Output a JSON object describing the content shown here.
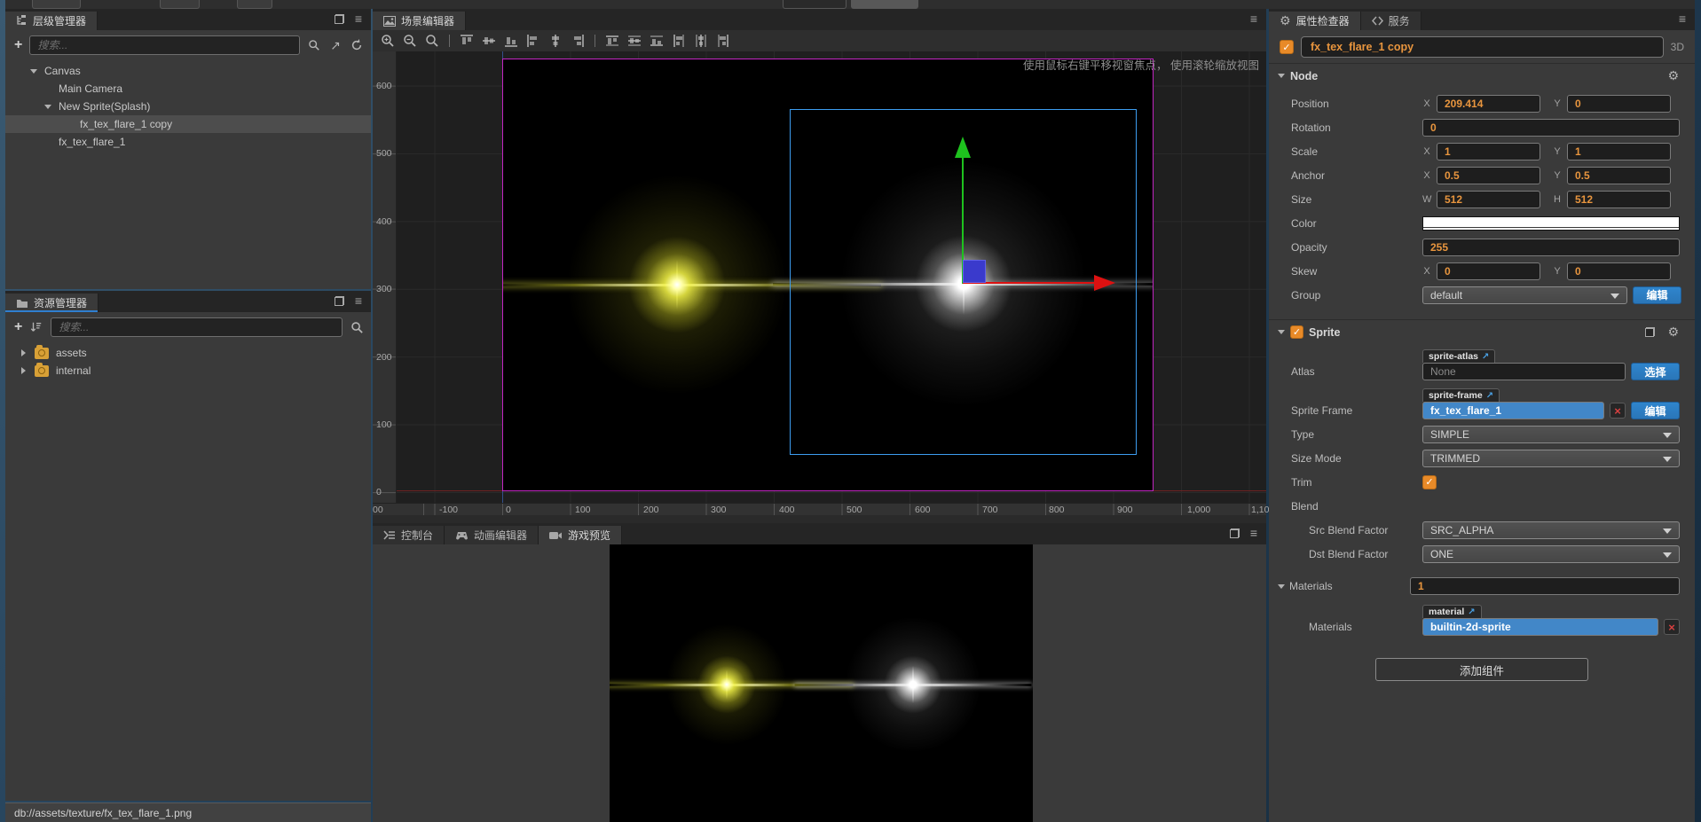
{
  "hierarchy": {
    "tab_label": "层级管理器",
    "search_placeholder": "搜索...",
    "tree": [
      {
        "label": "Canvas"
      },
      {
        "label": "Main Camera"
      },
      {
        "label": "New Sprite(Splash)"
      },
      {
        "label": "fx_tex_flare_1 copy"
      },
      {
        "label": "fx_tex_flare_1"
      }
    ]
  },
  "assets": {
    "tab_label": "资源管理器",
    "search_placeholder": "搜索...",
    "tree": [
      {
        "label": "assets"
      },
      {
        "label": "internal"
      }
    ],
    "status_bar": "db://assets/texture/fx_tex_flare_1.png"
  },
  "scene": {
    "tab_label": "场景编辑器",
    "hint": "使用鼠标右键平移视窗焦点， 使用滚轮缩放视图",
    "ruler_y": [
      "600",
      "500",
      "400",
      "300",
      "200",
      "100",
      "0"
    ],
    "ruler_x": [
      "00",
      "-100",
      "0",
      "100",
      "200",
      "300",
      "400",
      "500",
      "600",
      "700",
      "800",
      "900",
      "1,000",
      "1,10"
    ]
  },
  "bottom_panel": {
    "tabs": [
      {
        "label": "控制台"
      },
      {
        "label": "动画编辑器"
      },
      {
        "label": "游戏预览"
      }
    ]
  },
  "inspector": {
    "tab_inspector": "属性检查器",
    "tab_services": "服务",
    "node_name": "fx_tex_flare_1 copy",
    "mode_label": "3D",
    "node": {
      "title": "Node",
      "position": {
        "label": "Position",
        "x_label": "X",
        "x": "209.414",
        "y_label": "Y",
        "y": "0"
      },
      "rotation": {
        "label": "Rotation",
        "value": "0"
      },
      "scale": {
        "label": "Scale",
        "x_label": "X",
        "x": "1",
        "y_label": "Y",
        "y": "1"
      },
      "anchor": {
        "label": "Anchor",
        "x_label": "X",
        "x": "0.5",
        "y_label": "Y",
        "y": "0.5"
      },
      "size": {
        "label": "Size",
        "w_label": "W",
        "w": "512",
        "h_label": "H",
        "h": "512"
      },
      "color": {
        "label": "Color",
        "value": "#FFFFFF"
      },
      "opacity": {
        "label": "Opacity",
        "value": "255"
      },
      "skew": {
        "label": "Skew",
        "x_label": "X",
        "x": "0",
        "y_label": "Y",
        "y": "0"
      },
      "group": {
        "label": "Group",
        "value": "default",
        "button": "编辑"
      }
    },
    "sprite": {
      "title": "Sprite",
      "atlas": {
        "label": "Atlas",
        "tag": "sprite-atlas",
        "value": "None",
        "button": "选择"
      },
      "sprite_frame": {
        "label": "Sprite Frame",
        "tag": "sprite-frame",
        "value": "fx_tex_flare_1",
        "button": "编辑"
      },
      "type": {
        "label": "Type",
        "value": "SIMPLE"
      },
      "size_mode": {
        "label": "Size Mode",
        "value": "TRIMMED"
      },
      "trim": {
        "label": "Trim",
        "checked": true
      },
      "blend": {
        "label": "Blend"
      },
      "src_blend": {
        "label": "Src Blend Factor",
        "value": "SRC_ALPHA"
      },
      "dst_blend": {
        "label": "Dst Blend Factor",
        "value": "ONE"
      }
    },
    "materials": {
      "title": "Materials",
      "count": "1",
      "row": {
        "label": "Materials",
        "tag": "material",
        "value": "builtin-2d-sprite"
      }
    },
    "add_component": "添加组件"
  }
}
